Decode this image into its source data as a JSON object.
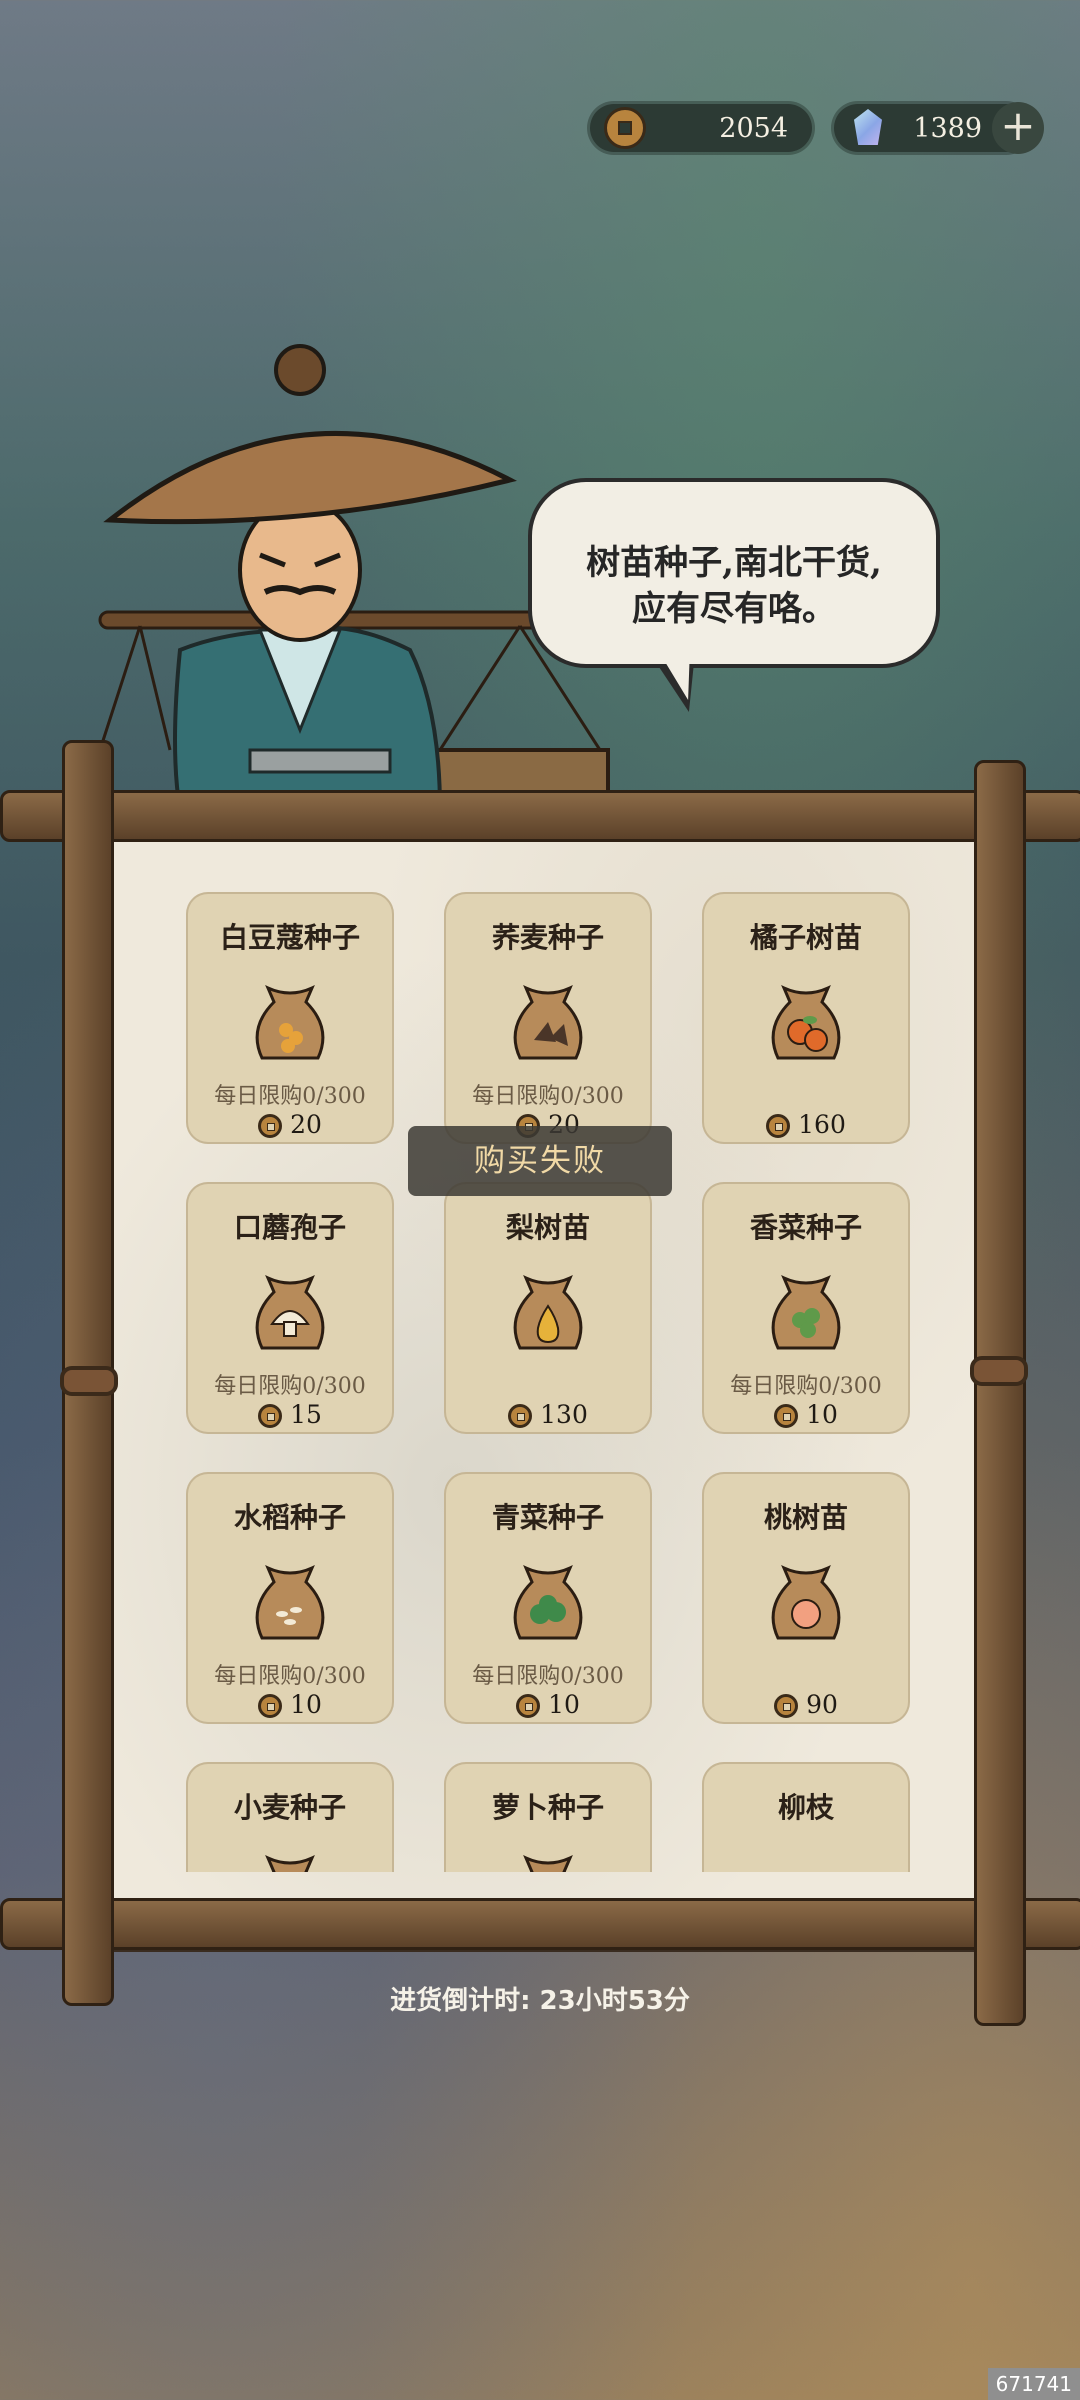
{
  "currency": {
    "coins": "2054",
    "gems": "1389",
    "add_label": "+"
  },
  "merchant": {
    "line1": "树苗种子,南北干货,",
    "line2": "应有尽有咯。"
  },
  "shop": {
    "items": [
      {
        "name": "白豆蔻种子",
        "limit": "每日限购0/300",
        "price": "20",
        "icon": "cardamom-icon",
        "color": "#e6a23a"
      },
      {
        "name": "荞麦种子",
        "limit": "每日限购0/300",
        "price": "20",
        "icon": "buckwheat-icon",
        "color": "#4a3528"
      },
      {
        "name": "橘子树苗",
        "limit": "",
        "price": "160",
        "icon": "tangerine-icon",
        "color": "#e06a2a"
      },
      {
        "name": "口蘑孢子",
        "limit": "每日限购0/300",
        "price": "15",
        "icon": "mushroom-icon",
        "color": "#f3ead6"
      },
      {
        "name": "梨树苗",
        "limit": "",
        "price": "130",
        "icon": "pear-icon",
        "color": "#e6b23a"
      },
      {
        "name": "香菜种子",
        "limit": "每日限购0/300",
        "price": "10",
        "icon": "coriander-icon",
        "color": "#5f9a4a"
      },
      {
        "name": "水稻种子",
        "limit": "每日限购0/300",
        "price": "10",
        "icon": "rice-icon",
        "color": "#f3ead6"
      },
      {
        "name": "青菜种子",
        "limit": "每日限购0/300",
        "price": "10",
        "icon": "greens-icon",
        "color": "#3f8a4a"
      },
      {
        "name": "桃树苗",
        "limit": "",
        "price": "90",
        "icon": "peach-icon",
        "color": "#f2a080"
      },
      {
        "name": "小麦种子",
        "limit": "",
        "price": "",
        "icon": "wheat-icon",
        "color": "#e6b23a"
      },
      {
        "name": "萝卜种子",
        "limit": "",
        "price": "",
        "icon": "radish-icon",
        "color": "#5f9a4a"
      },
      {
        "name": "柳枝",
        "limit": "",
        "price": "",
        "icon": "willow-icon",
        "color": "#5f9a4a"
      }
    ]
  },
  "toast": "购买失败",
  "timer": "进货倒计时: 23小时53分",
  "corner_code": "671741"
}
